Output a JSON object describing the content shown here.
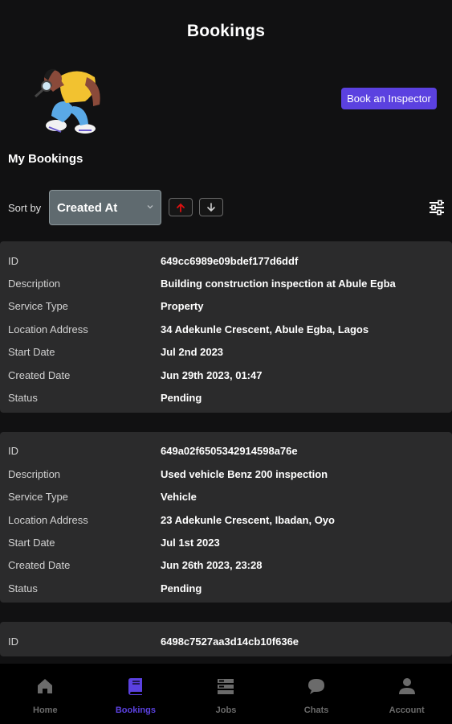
{
  "header": {
    "title": "Bookings"
  },
  "hero": {
    "book_button_label": "Book an Inspector"
  },
  "section_title": "My Bookings",
  "sort": {
    "label": "Sort by",
    "selected": "Created At"
  },
  "bookings": [
    {
      "rows": [
        {
          "label": "ID",
          "value": "649cc6989e09bdef177d6ddf"
        },
        {
          "label": "Description",
          "value": "Building construction inspection at Abule Egba"
        },
        {
          "label": "Service Type",
          "value": "Property"
        },
        {
          "label": "Location Address",
          "value": "34 Adekunle Crescent, Abule Egba, Lagos"
        },
        {
          "label": "Start Date",
          "value": "Jul 2nd 2023"
        },
        {
          "label": "Created Date",
          "value": "Jun 29th 2023, 01:47"
        },
        {
          "label": "Status",
          "value": "Pending"
        }
      ]
    },
    {
      "rows": [
        {
          "label": "ID",
          "value": "649a02f6505342914598a76e"
        },
        {
          "label": "Description",
          "value": "Used vehicle Benz 200 inspection"
        },
        {
          "label": "Service Type",
          "value": "Vehicle"
        },
        {
          "label": "Location Address",
          "value": "23 Adekunle Crescent, Ibadan, Oyo"
        },
        {
          "label": "Start Date",
          "value": "Jul 1st 2023"
        },
        {
          "label": "Created Date",
          "value": "Jun 26th 2023, 23:28"
        },
        {
          "label": "Status",
          "value": "Pending"
        }
      ]
    },
    {
      "rows": [
        {
          "label": "ID",
          "value": "6498c7527aa3d14cb10f636e"
        }
      ]
    }
  ],
  "nav": {
    "items": [
      {
        "label": "Home",
        "icon": "home-icon"
      },
      {
        "label": "Bookings",
        "icon": "book-icon"
      },
      {
        "label": "Jobs",
        "icon": "jobs-icon"
      },
      {
        "label": "Chats",
        "icon": "chat-icon"
      },
      {
        "label": "Account",
        "icon": "person-icon"
      }
    ],
    "active_index": 1
  },
  "colors": {
    "background": "#111112",
    "card": "#2b2b2c",
    "accent": "#5b41e0",
    "sort_up_arrow": "#e01010"
  }
}
